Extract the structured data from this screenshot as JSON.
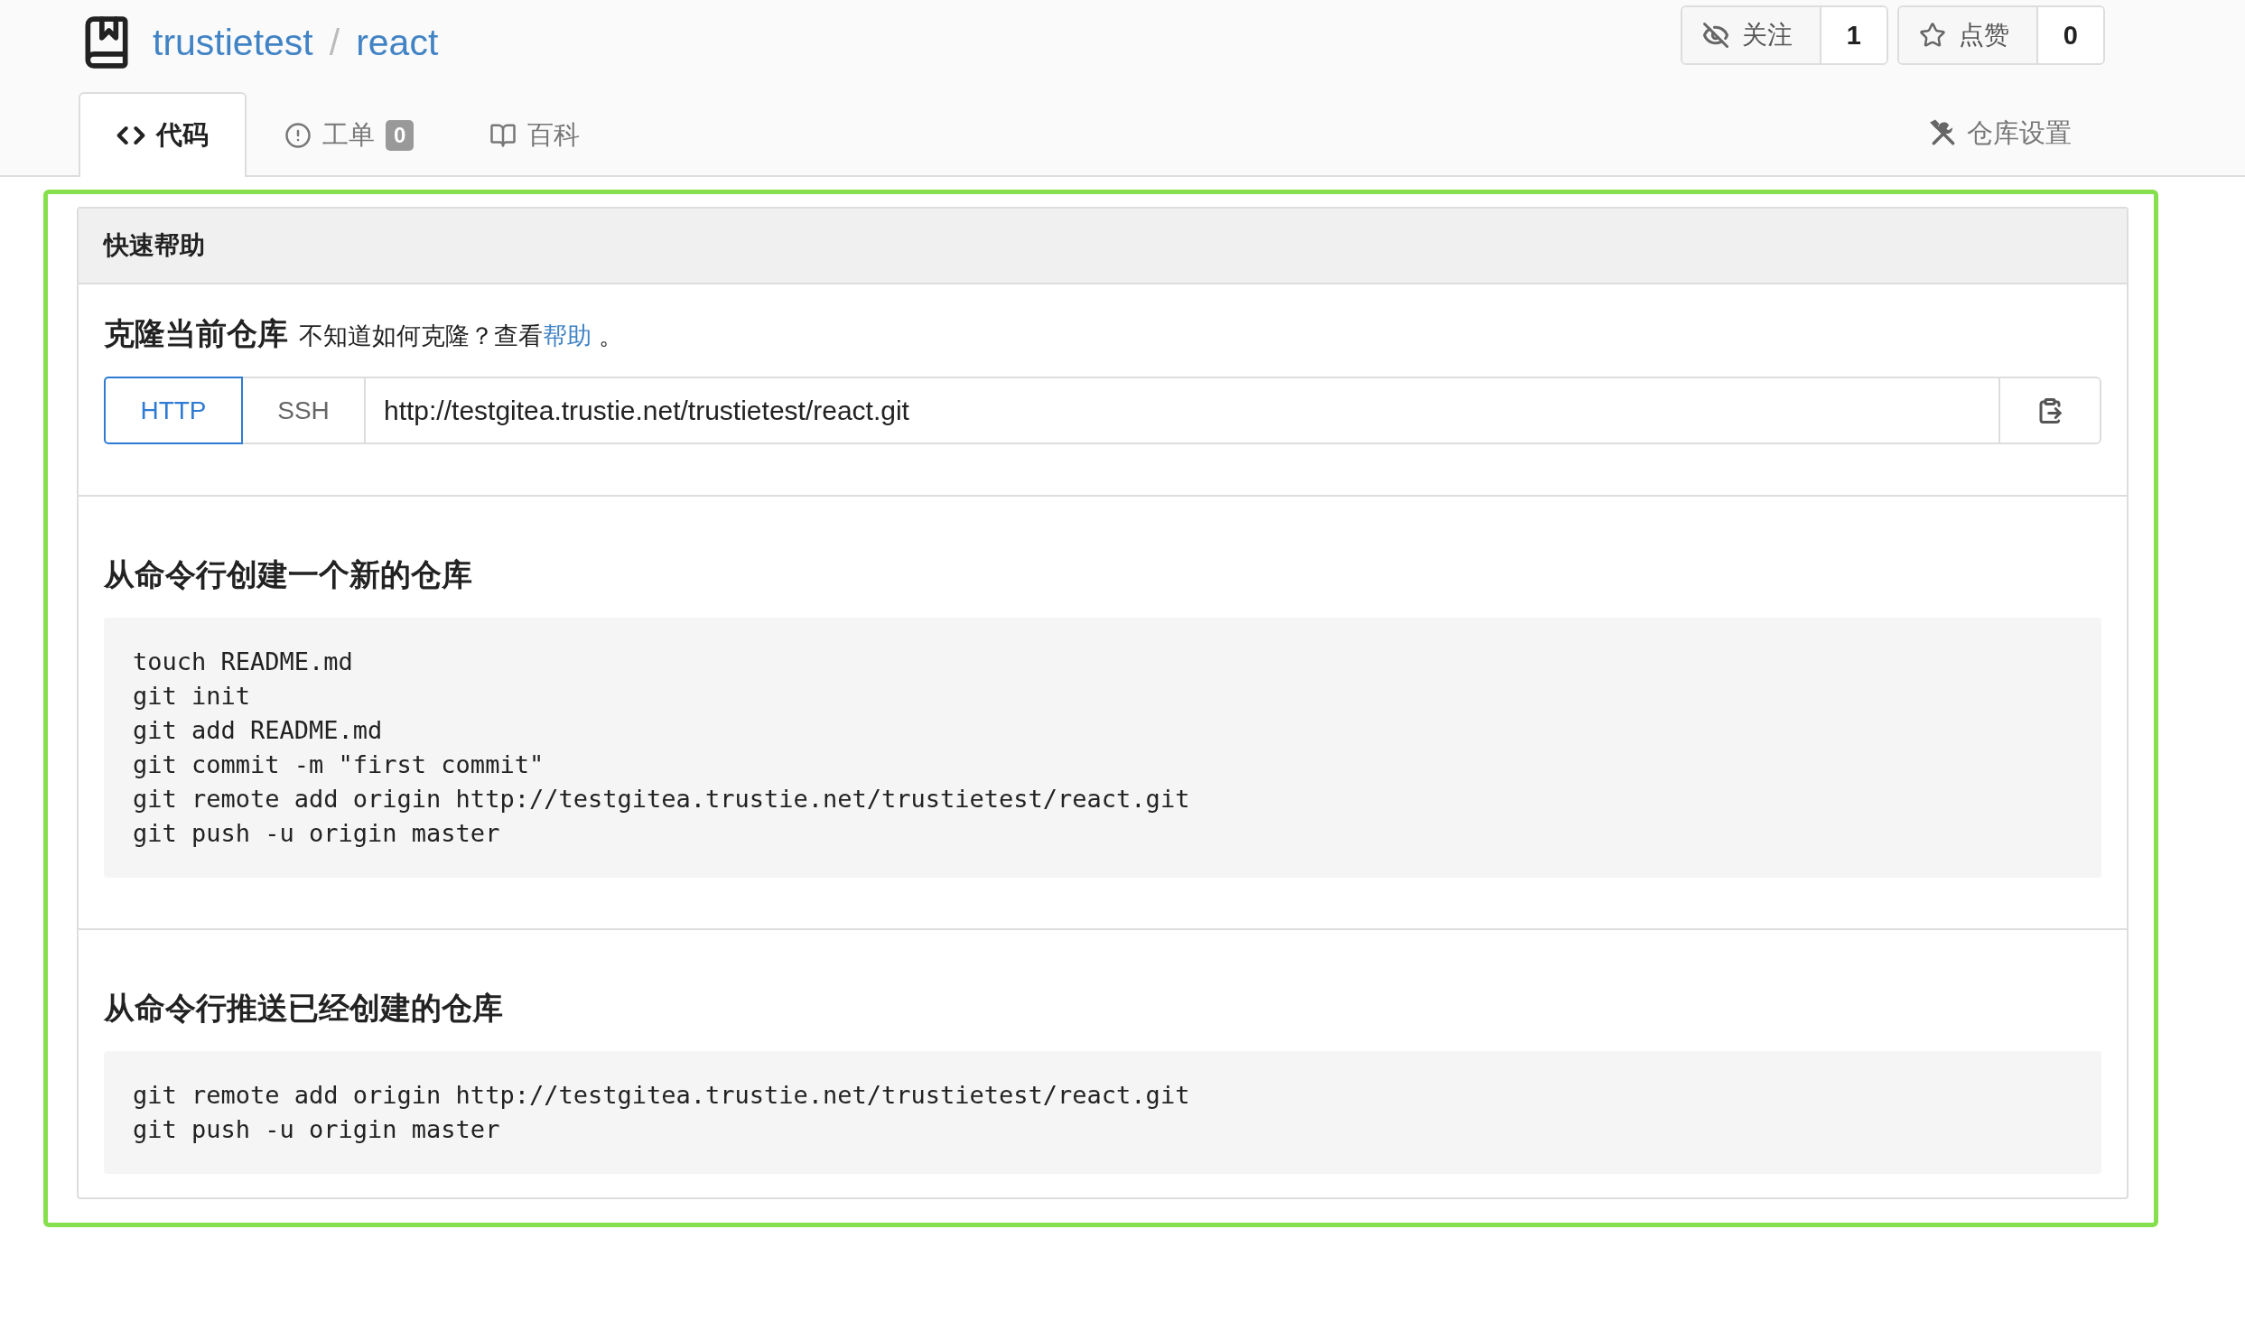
{
  "repo": {
    "owner": "trustietest",
    "separator": "/",
    "name": "react"
  },
  "actions": [
    {
      "kind": "watch",
      "label": "关注",
      "count": "1"
    },
    {
      "kind": "star",
      "label": "点赞",
      "count": "0"
    }
  ],
  "tabs": [
    {
      "kind": "code",
      "label": "代码",
      "selected": true
    },
    {
      "kind": "issues",
      "label": "工单",
      "badge": "0",
      "selected": false
    },
    {
      "kind": "wiki",
      "label": "百科",
      "selected": false
    }
  ],
  "settings": {
    "label": "仓库设置"
  },
  "quick_help": {
    "title": "快速帮助",
    "clone": {
      "title": "克隆当前仓库",
      "hint": "不知道如何克隆？查看",
      "link": "帮助",
      "end": " 。",
      "protocols": [
        {
          "label": "HTTP",
          "selected": true
        },
        {
          "label": "SSH",
          "selected": false
        }
      ],
      "url": "http://testgitea.trustie.net/trustietest/react.git"
    },
    "sections": [
      {
        "title": "从命令行创建一个新的仓库",
        "lines": [
          "touch README.md",
          "git init",
          "git add README.md",
          "git commit -m \"first commit\"",
          "git remote add origin http://testgitea.trustie.net/trustietest/react.git",
          "git push -u origin master"
        ]
      },
      {
        "title": "从命令行推送已经创建的仓库",
        "lines": [
          "git remote add origin http://testgitea.trustie.net/trustietest/react.git",
          "git push -u origin master"
        ]
      }
    ]
  }
}
